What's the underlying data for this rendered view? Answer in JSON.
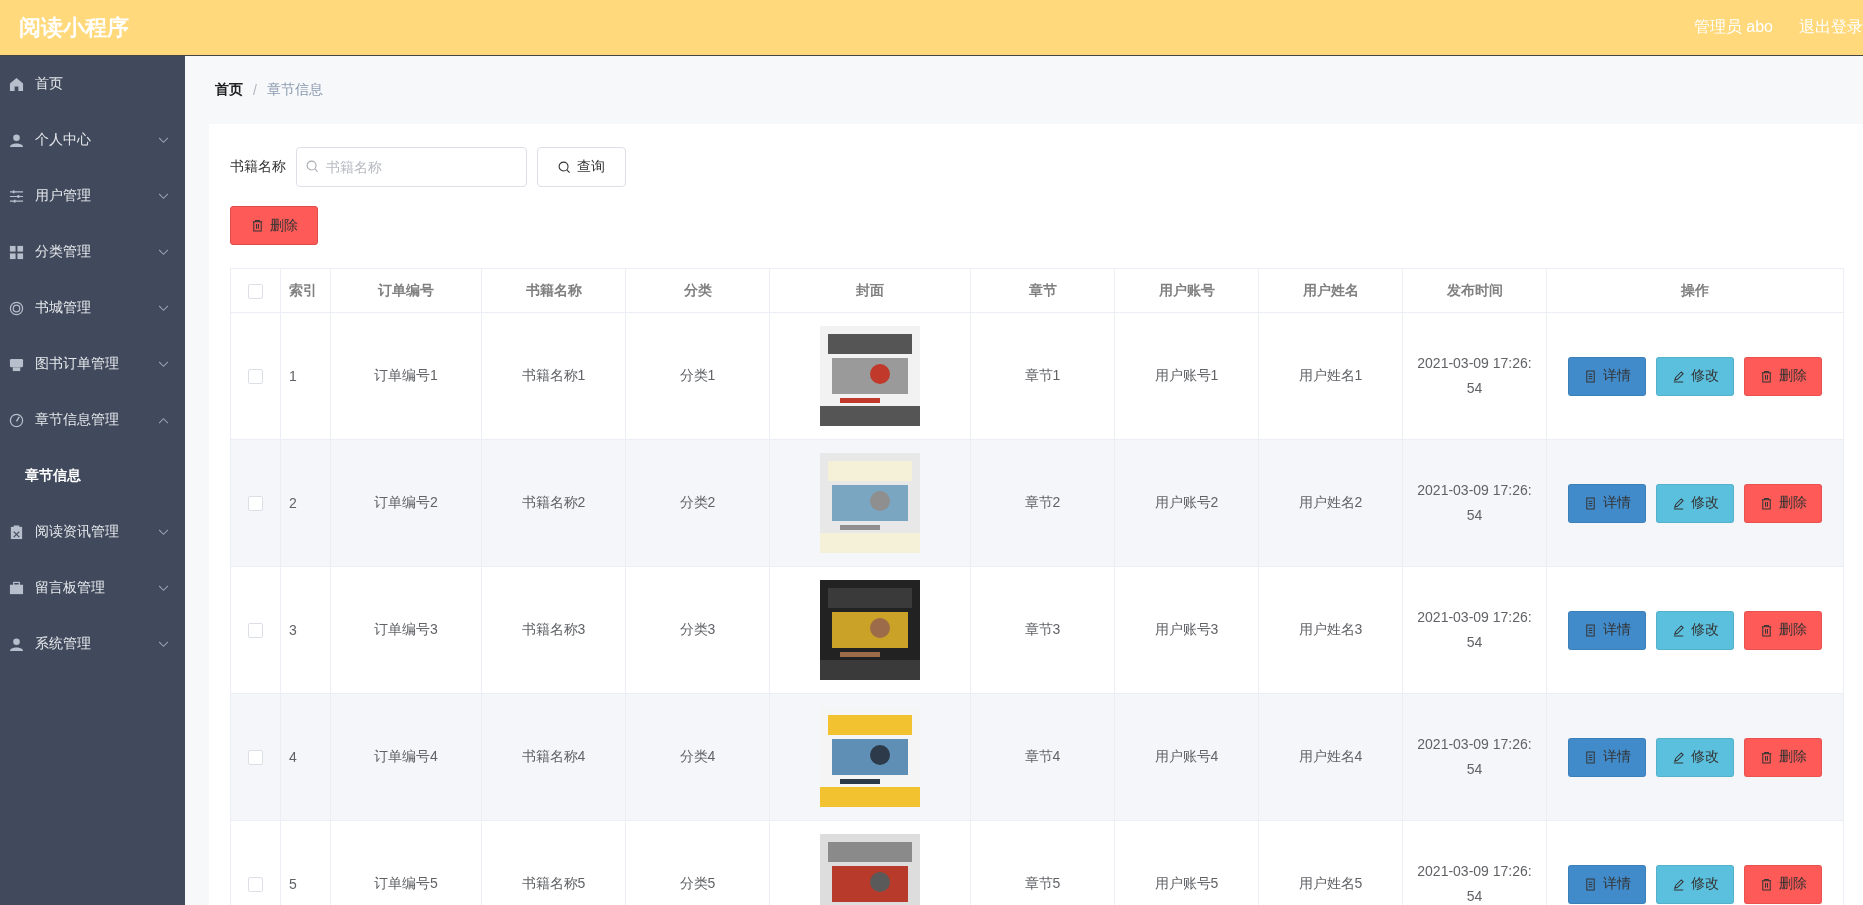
{
  "header": {
    "title": "阅读小程序",
    "user": "管理员 abo",
    "logout": "退出登录"
  },
  "sidebar": {
    "items": [
      {
        "label": "首页",
        "kind": "link"
      },
      {
        "label": "个人中心",
        "kind": "menu",
        "expanded": false
      },
      {
        "label": "用户管理",
        "kind": "menu",
        "expanded": false
      },
      {
        "label": "分类管理",
        "kind": "menu",
        "expanded": false
      },
      {
        "label": "书城管理",
        "kind": "menu",
        "expanded": false
      },
      {
        "label": "图书订单管理",
        "kind": "menu",
        "expanded": false
      },
      {
        "label": "章节信息管理",
        "kind": "menu",
        "expanded": true,
        "children": [
          {
            "label": "章节信息"
          }
        ]
      },
      {
        "label": "阅读资讯管理",
        "kind": "menu",
        "expanded": false
      },
      {
        "label": "留言板管理",
        "kind": "menu",
        "expanded": false
      },
      {
        "label": "系统管理",
        "kind": "menu",
        "expanded": false
      }
    ]
  },
  "breadcrumb": {
    "items": [
      "首页",
      "章节信息"
    ],
    "separator": "/"
  },
  "search": {
    "label": "书籍名称",
    "placeholder": "书籍名称",
    "button": "查询"
  },
  "delete_button": "删除",
  "table": {
    "header_checked": false,
    "columns": [
      "索引",
      "订单编号",
      "书籍名称",
      "分类",
      "封面",
      "章节",
      "用户账号",
      "用户姓名",
      "发布时间",
      "操作"
    ],
    "rows": [
      {
        "checked": false,
        "index": "1",
        "order": "订单编号1",
        "book": "书籍名称1",
        "category": "分类1",
        "chapter": "章节1",
        "account": "用户账号1",
        "name": "用户姓名1",
        "time": "2021-03-09 17:26:54",
        "actions": [
          "详情",
          "修改",
          "删除"
        ]
      },
      {
        "checked": false,
        "index": "2",
        "order": "订单编号2",
        "book": "书籍名称2",
        "category": "分类2",
        "chapter": "章节2",
        "account": "用户账号2",
        "name": "用户姓名2",
        "time": "2021-03-09 17:26:54",
        "actions": [
          "详情",
          "修改",
          "删除"
        ]
      },
      {
        "checked": false,
        "index": "3",
        "order": "订单编号3",
        "book": "书籍名称3",
        "category": "分类3",
        "chapter": "章节3",
        "account": "用户账号3",
        "name": "用户姓名3",
        "time": "2021-03-09 17:26:54",
        "actions": [
          "详情",
          "修改",
          "删除"
        ]
      },
      {
        "checked": false,
        "index": "4",
        "order": "订单编号4",
        "book": "书籍名称4",
        "category": "分类4",
        "chapter": "章节4",
        "account": "用户账号4",
        "name": "用户姓名4",
        "time": "2021-03-09 17:26:54",
        "actions": [
          "详情",
          "修改",
          "删除"
        ]
      },
      {
        "checked": false,
        "index": "5",
        "order": "订单编号5",
        "book": "书籍名称5",
        "category": "分类5",
        "chapter": "章节5",
        "account": "用户账号5",
        "name": "用户姓名5",
        "time": "2021-03-09 17:26:54",
        "actions": [
          "详情",
          "修改",
          "删除"
        ]
      }
    ]
  }
}
